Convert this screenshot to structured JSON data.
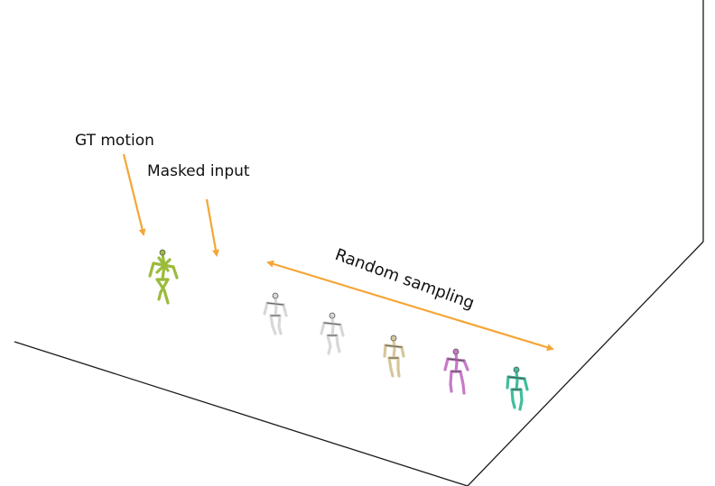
{
  "labels": {
    "gt_motion": "GT motion",
    "masked_input": "Masked input",
    "random_sampling": "Random sampling"
  },
  "colors": {
    "arrow": "#f5a536",
    "floor_line": "#1a1a1a",
    "gt_figure": "#9bbb3c",
    "sample_1": "#d8d8d8",
    "sample_2": "#d8d8d8",
    "sample_3": "#d6c79a",
    "sample_4": "#c779c8",
    "sample_5": "#3fbf9c"
  },
  "icons": {
    "figures": "stick-skeleton-icon",
    "arrows": "arrow-icon"
  }
}
